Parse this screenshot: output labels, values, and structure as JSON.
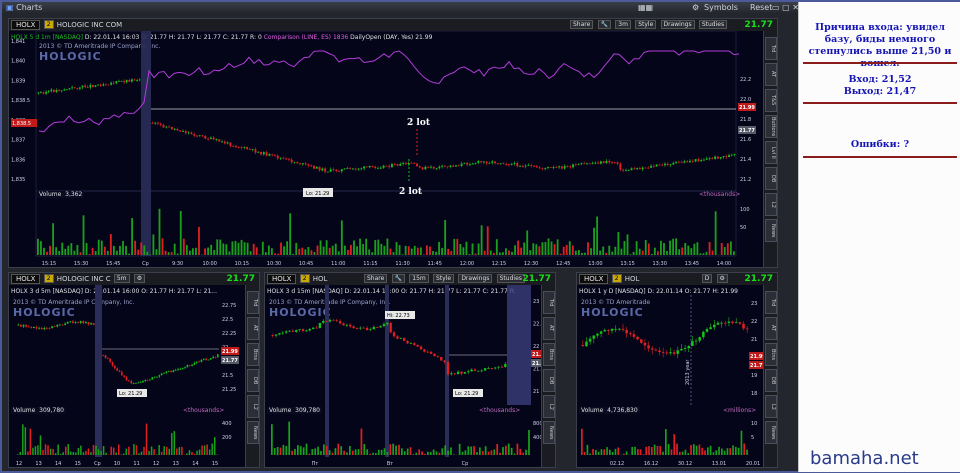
{
  "window": {
    "title": "Charts",
    "buttons": [
      "Symbols",
      "Reset"
    ],
    "symbol": "HOLX",
    "badge": "2"
  },
  "main_panel": {
    "company": "HOLOGIC INC COM",
    "controls": [
      "Share",
      "3m",
      "Style",
      "Drawings",
      "Studies"
    ],
    "price": "21.77",
    "info": {
      "symbol_label": "HOLX 5 d 1m [NASDAQ]",
      "date": "D: 22.01.14 16:03",
      "open": "O: 21.77",
      "high": "H: 21.77",
      "low": "L: 21.77",
      "close": "C: 21.77",
      "range": "R: 0",
      "comparison": "Comparison (LINE, ES)",
      "comparison_val": "1836",
      "daily_open": "DailyOpen (DAY, Yes)",
      "daily_open_val": "21.99"
    },
    "copyright": "2013 © TD Ameritrade IP Company, Inc.",
    "logo": "HOLOGIC",
    "left_axis": [
      "1,841",
      "1,840",
      "1,839",
      "1,838.5",
      "1,838",
      "1,837",
      "1,836",
      "1,835"
    ],
    "right_axis": [
      "22.2",
      "22.0",
      "21.8",
      "21.6",
      "21.4",
      "21.2"
    ],
    "right_tags": {
      "daily_open": "21.99",
      "last": "21.77"
    },
    "annotations": {
      "top": "2 lot",
      "bottom": "2 lot",
      "low": "Lo: 21.29"
    },
    "volume_label": "Volume",
    "volume_value": "3,362",
    "volume_unit": "<thousands>",
    "volume_axis": [
      "100",
      "50"
    ],
    "time_axis": [
      "15:15",
      "15:30",
      "15:45",
      "Cp",
      "9:30",
      "10:00",
      "10:15",
      "10:30",
      "10:45",
      "11:00",
      "11:15",
      "11:30",
      "11:45",
      "12:00",
      "12:15",
      "12:30",
      "12:45",
      "13:00",
      "13:15",
      "13:30",
      "13:45",
      "14:00"
    ],
    "side_tabs": [
      "Trd",
      "AT",
      "T&S",
      "Buttons",
      "Lvl II",
      "DB",
      "L2",
      "News"
    ]
  },
  "panel_a": {
    "symbol": "HOLX",
    "company": "HOLOGIC INC C",
    "timeframe": "5m",
    "price": "21.77",
    "info": "HOLX 3 d 5m [NASDAQ]  D: 22.01.14 16:00  O: 21.77  H: 21.77  L: 21...",
    "copyright": "2013 © TD Ameritrade IP Company, Inc.",
    "logo": "HOLOGIC",
    "right_axis": [
      "22.75",
      "22.5",
      "22.25",
      "22",
      "21.75",
      "21.5",
      "21.25"
    ],
    "tags": {
      "daily_open": "21.99",
      "last": "21.77"
    },
    "low": "Lo: 21.29",
    "volume_label": "Volume",
    "volume_value": "309,780",
    "volume_unit": "<thousands>",
    "volume_axis": [
      "400",
      "200"
    ],
    "time_axis": [
      "12",
      "13",
      "14",
      "15",
      "Cp",
      "10",
      "11",
      "12",
      "13",
      "14",
      "15"
    ]
  },
  "panel_b": {
    "symbol": "HOLX",
    "company": "HOL",
    "timeframe": "15m",
    "controls": [
      "Share",
      "Style",
      "Drawings",
      "Studies"
    ],
    "price": "21.77",
    "info": "HOLX 3 d 15m [NASDAQ]  D: 22.01.14 16:00  O: 21.77  H: 21.77  L: 21.77  C: 21.77  R:",
    "copyright": "2013 © TD Ameritrade IP Company, Inc.",
    "logo": "HOLOGIC",
    "right_axis": [
      "23",
      "22.5",
      "22",
      "21.5",
      "21"
    ],
    "tags": {
      "daily_open": "21.99",
      "last": "21.77"
    },
    "high": "Hi: 22.73",
    "low": "Lo: 21.29",
    "volume_label": "Volume",
    "volume_value": "309,780",
    "volume_unit": "<thousands>",
    "volume_axis": [
      "800",
      "400"
    ],
    "time_axis": [
      "Пт",
      "Вт",
      "Ср"
    ]
  },
  "panel_c": {
    "symbol": "HOLX",
    "company": "HOL",
    "timeframe": "D",
    "price": "21.77",
    "info": "HOLX 1 y D [NASDAQ]  D: 22.01.14  O: 21.77  H: 21.99",
    "copyright": "2013 © TD Ameritrade",
    "logo": "HOLOGIC",
    "right_axis": [
      "23",
      "22",
      "21",
      "20",
      "19",
      "18"
    ],
    "tags": {
      "daily_open": "21.99",
      "last": "21.77"
    },
    "vertical_label": "2013 year",
    "volume_label": "Volume",
    "volume_value": "4,736,830",
    "volume_unit": "<millions>",
    "volume_axis": [
      "10",
      "5"
    ],
    "time_axis": [
      "02.12",
      "16.12",
      "30.12",
      "13.01",
      "20.01"
    ]
  },
  "notes": {
    "reason": "Причина входа: увидел базу, биды немного степнулись выше 21,50 и вошел.",
    "entry": "Вход: 21,52",
    "exit": "Выход: 21,47",
    "errors": "Ошибки: ?"
  },
  "brand": "bamaha.net",
  "colors": {
    "chart_bg": "#05051a",
    "up_candle": "#18c018",
    "down_candle": "#e02020",
    "comparison_line": "#b43cdc",
    "daily_open_line": "#cfcfcf",
    "volume": "#1aa01a",
    "note_text": "#1414b4",
    "divider": "#8a1c1c"
  }
}
